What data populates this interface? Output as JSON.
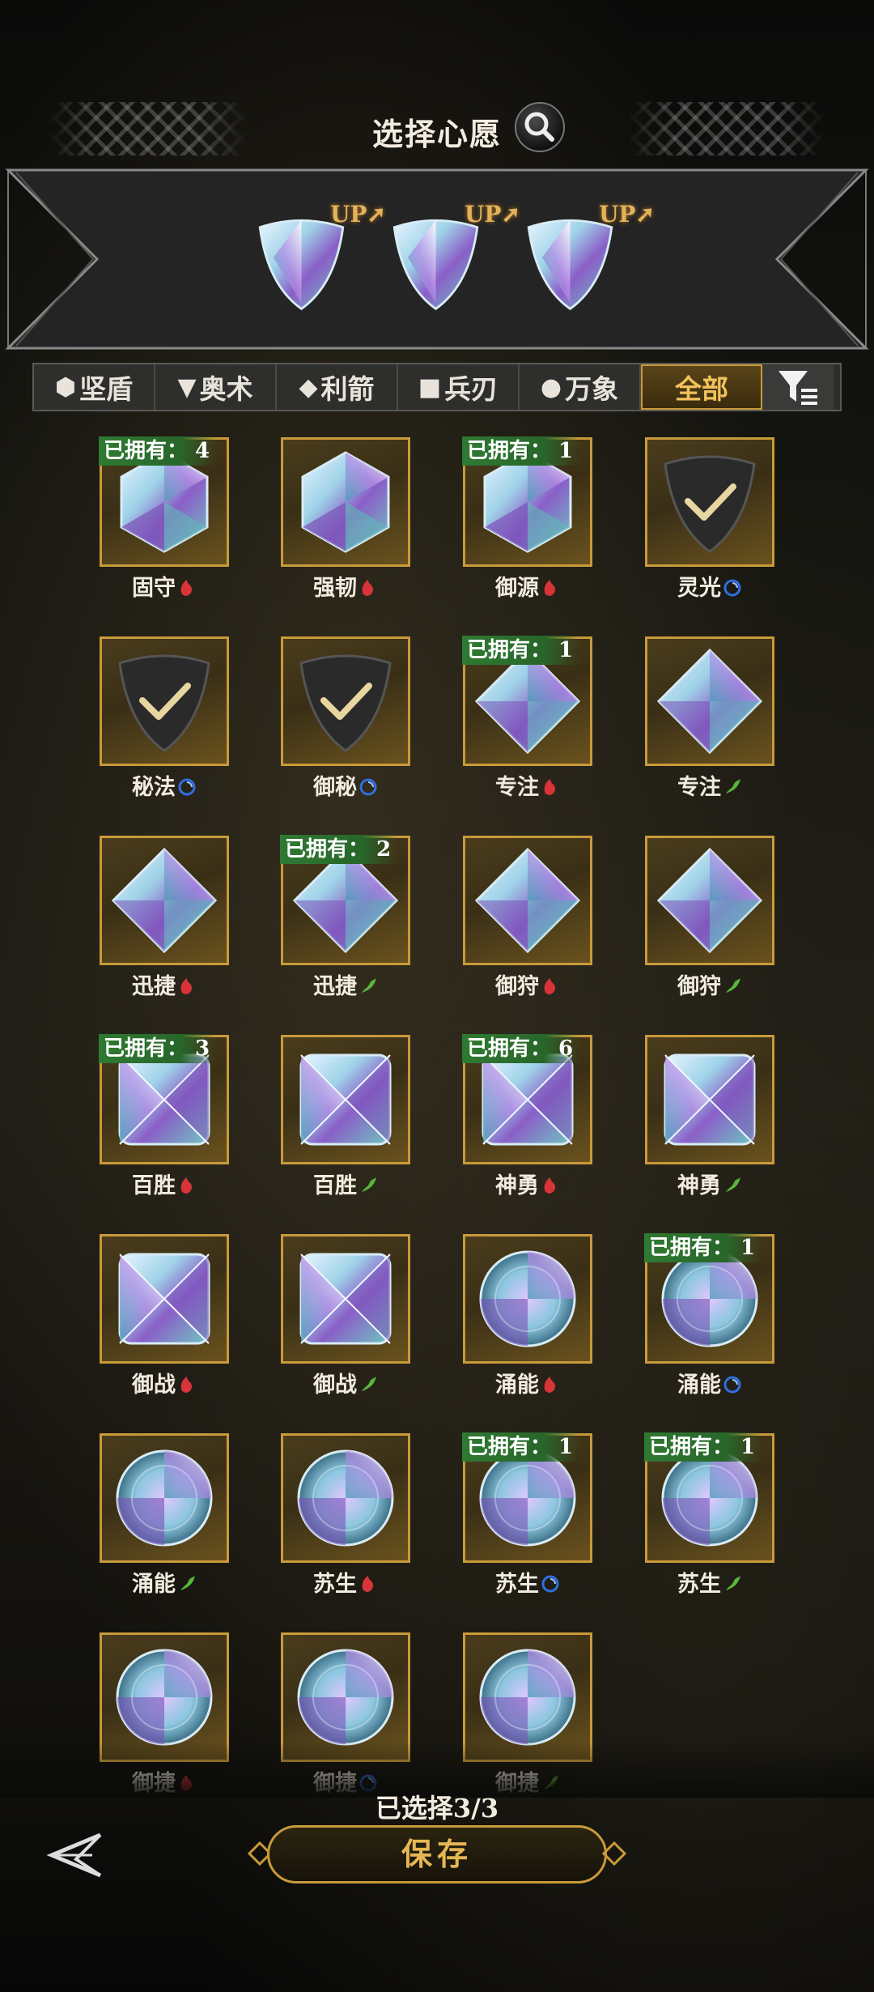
{
  "header": {
    "title": "选择心愿"
  },
  "wish_slots": [
    {
      "badge": "UP"
    },
    {
      "badge": "UP"
    },
    {
      "badge": "UP"
    }
  ],
  "tabs": [
    {
      "symbol": "⬢",
      "label": "坚盾",
      "active": false
    },
    {
      "symbol": "▼",
      "label": "奥术",
      "active": false
    },
    {
      "symbol": "◆",
      "label": "利箭",
      "active": false
    },
    {
      "symbol": "■",
      "label": "兵刃",
      "active": false
    },
    {
      "symbol": "●",
      "label": "万象",
      "active": false
    },
    {
      "symbol": "",
      "label": "全部",
      "active": true
    }
  ],
  "owned_prefix": "已拥有：",
  "colors": {
    "accent": "#c99a3a",
    "owned_badge": "#2f7a32",
    "red": "#d8343a",
    "blue": "#2f6fe0",
    "green": "#58b63a"
  },
  "items": [
    {
      "name": "固守",
      "element": "red",
      "shape": "hexagon",
      "owned": "4"
    },
    {
      "name": "强韧",
      "element": "red",
      "shape": "hexagon",
      "owned": ""
    },
    {
      "name": "御源",
      "element": "red",
      "shape": "hexagon",
      "owned": "1"
    },
    {
      "name": "灵光",
      "element": "blue",
      "shape": "triangle",
      "owned": "",
      "selected": true
    },
    {
      "name": "秘法",
      "element": "blue",
      "shape": "triangle",
      "owned": "",
      "selected": true
    },
    {
      "name": "御秘",
      "element": "blue",
      "shape": "triangle",
      "owned": "",
      "selected": true
    },
    {
      "name": "专注",
      "element": "red",
      "shape": "diamond",
      "owned": "1"
    },
    {
      "name": "专注",
      "element": "green",
      "shape": "diamond",
      "owned": ""
    },
    {
      "name": "迅捷",
      "element": "red",
      "shape": "diamond",
      "owned": ""
    },
    {
      "name": "迅捷",
      "element": "green",
      "shape": "diamond",
      "owned": "2"
    },
    {
      "name": "御狩",
      "element": "red",
      "shape": "diamond",
      "owned": ""
    },
    {
      "name": "御狩",
      "element": "green",
      "shape": "diamond",
      "owned": ""
    },
    {
      "name": "百胜",
      "element": "red",
      "shape": "square",
      "owned": "3"
    },
    {
      "name": "百胜",
      "element": "green",
      "shape": "square",
      "owned": ""
    },
    {
      "name": "神勇",
      "element": "red",
      "shape": "square",
      "owned": "6"
    },
    {
      "name": "神勇",
      "element": "green",
      "shape": "square",
      "owned": ""
    },
    {
      "name": "御战",
      "element": "red",
      "shape": "square",
      "owned": ""
    },
    {
      "name": "御战",
      "element": "green",
      "shape": "square",
      "owned": ""
    },
    {
      "name": "涌能",
      "element": "red",
      "shape": "circle",
      "owned": ""
    },
    {
      "name": "涌能",
      "element": "blue",
      "shape": "circle",
      "owned": "1"
    },
    {
      "name": "涌能",
      "element": "green",
      "shape": "circle",
      "owned": ""
    },
    {
      "name": "苏生",
      "element": "red",
      "shape": "circle",
      "owned": ""
    },
    {
      "name": "苏生",
      "element": "blue",
      "shape": "circle",
      "owned": "1"
    },
    {
      "name": "苏生",
      "element": "green",
      "shape": "circle",
      "owned": "1"
    },
    {
      "name": "御捷",
      "element": "red",
      "shape": "circle",
      "owned": ""
    },
    {
      "name": "御捷",
      "element": "blue",
      "shape": "circle",
      "owned": ""
    },
    {
      "name": "御捷",
      "element": "green",
      "shape": "circle",
      "owned": ""
    }
  ],
  "footer": {
    "selected_text": "已选择3/3",
    "save_label": "保存"
  }
}
